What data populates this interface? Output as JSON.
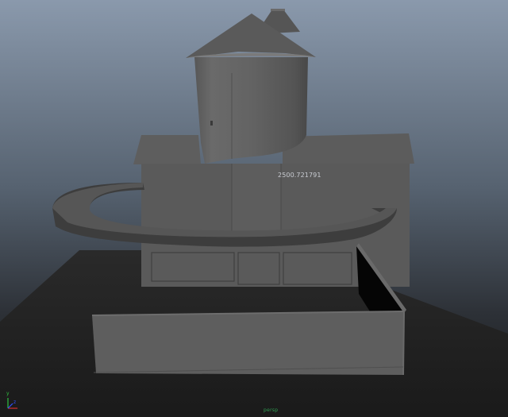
{
  "viewport": {
    "background_top_color": "#8a99ac",
    "background_bottom_color": "#151618",
    "distance_readout": "2500.721791",
    "camera_label": "persp"
  },
  "axis_gizmo": {
    "x_color": "#d03030",
    "y_color": "#30c040",
    "z_color": "#3050ff",
    "y_label": "y",
    "z_label": "z"
  },
  "scene": {
    "objects": [
      "ground-plane",
      "tower-cylinder",
      "tower-roof-cone",
      "tower-chimney-cone",
      "main-building",
      "curved-walkway-ring",
      "front-wall-enclosure"
    ]
  }
}
